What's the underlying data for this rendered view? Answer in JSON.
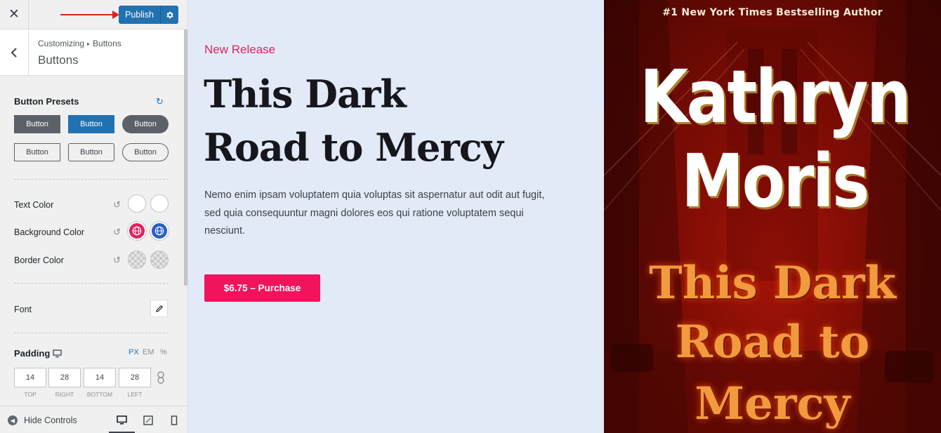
{
  "topbar": {
    "close_glyph": "✕",
    "publish_label": "Publish",
    "settings_icon": "gear-icon"
  },
  "section": {
    "breadcrumb_root": "Customizing",
    "breadcrumb_current": "Buttons",
    "title": "Buttons"
  },
  "button_presets": {
    "label": "Button Presets",
    "presets": [
      "Button",
      "Button",
      "Button",
      "Button",
      "Button",
      "Button"
    ]
  },
  "colors": {
    "text_color_label": "Text Color",
    "background_color_label": "Background Color",
    "border_color_label": "Border Color",
    "text_swatches": [
      "#ffffff",
      "#ffffff"
    ],
    "background_swatches": [
      "#e0245e",
      "#2a5fc4"
    ]
  },
  "font": {
    "label": "Font"
  },
  "padding": {
    "label": "Padding",
    "units": [
      "PX",
      "EM",
      "%"
    ],
    "active_unit": "PX",
    "values": [
      "14",
      "28",
      "14",
      "28"
    ],
    "captions": [
      "TOP",
      "RIGHT",
      "BOTTOM",
      "LEFT"
    ]
  },
  "footer": {
    "hide_controls_label": "Hide Controls",
    "devices": [
      "desktop",
      "tablet",
      "mobile"
    ],
    "active_device": "desktop"
  },
  "preview": {
    "eyebrow": "New Release",
    "headline_line1": "This Dark",
    "headline_line2": "Road to Mercy",
    "description": "Nemo enim ipsam voluptatem quia voluptas sit aspernatur aut odit aut fugit, sed quia consequuntur magni dolores eos qui ratione voluptatem sequi nesciunt.",
    "button_label": "$6.75 – Purchase",
    "accent_color": "#f0145a",
    "background_color": "#e2eaf8"
  },
  "cover": {
    "tagline": "#1 New York Times Bestselling Author",
    "author_first": "Kathryn",
    "author_last": "Moris",
    "title_line1": "This Dark",
    "title_line2": "Road to",
    "title_line3": "Mercy"
  }
}
